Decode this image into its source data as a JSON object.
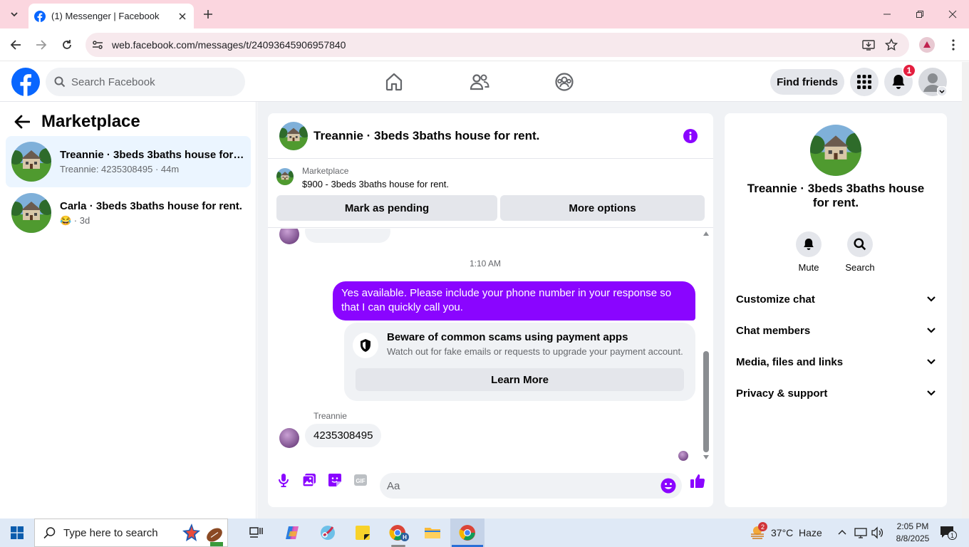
{
  "browser": {
    "tab_title": "(1) Messenger | Facebook",
    "url": "web.facebook.com/messages/t/24093645906957840"
  },
  "fb_header": {
    "search_placeholder": "Search Facebook",
    "find_friends": "Find friends",
    "notification_count": "1"
  },
  "left_panel": {
    "title": "Marketplace",
    "conversations": [
      {
        "title": "Treannie · 3beds 3baths house for ...",
        "subtitle": "Treannie: 4235308495 · 44m"
      },
      {
        "title": "Carla · 3beds 3baths house for rent.",
        "subtitle": "😂 · 3d"
      }
    ]
  },
  "chat": {
    "header_name": "Treannie · 3beds 3baths house for rent.",
    "marketplace_label": "Marketplace",
    "listing": "$900 - 3beds 3baths house for rent.",
    "mark_pending": "Mark as pending",
    "more_options": "More options",
    "timestamp": "1:10 AM",
    "outgoing_message": "Yes available. Please include your phone number in your response so that I can quickly call you.",
    "scam_title": "Beware of common scams using payment apps",
    "scam_subtitle": "Watch out for fake emails or requests to upgrade your payment account.",
    "learn_more": "Learn More",
    "sender_name": "Treannie",
    "incoming_message": "4235308495",
    "input_placeholder": "Aa"
  },
  "right_panel": {
    "name": "Treannie · 3beds 3baths house for rent.",
    "mute": "Mute",
    "search": "Search",
    "sections": [
      "Customize chat",
      "Chat members",
      "Media, files and links",
      "Privacy & support"
    ]
  },
  "taskbar": {
    "search_placeholder": "Type here to search",
    "weather_badge": "2",
    "weather": "37°C  Haze",
    "time": "2:05 PM",
    "date": "8/8/2025",
    "notif_count": "1"
  },
  "colors": {
    "fb_blue": "#0866ff",
    "messenger_purple": "#8a05ff",
    "active_bg": "#ebf5ff"
  }
}
